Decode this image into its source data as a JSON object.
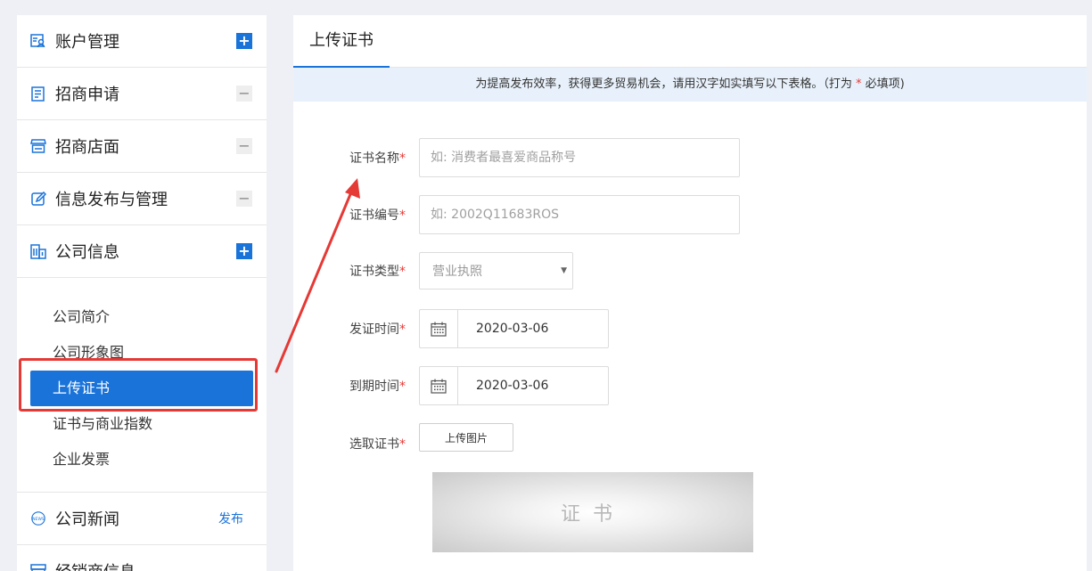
{
  "sidebar": {
    "items": [
      {
        "label": "账户管理",
        "icon": "account-icon",
        "toggle": "+"
      },
      {
        "label": "招商申请",
        "icon": "apply-icon",
        "toggle": "−"
      },
      {
        "label": "招商店面",
        "icon": "store-icon",
        "toggle": "−"
      },
      {
        "label": "信息发布与管理",
        "icon": "edit-icon",
        "toggle": "−"
      },
      {
        "label": "公司信息",
        "icon": "building-icon",
        "toggle": "+"
      }
    ],
    "company_sub": [
      "公司简介",
      "公司形象图",
      "上传证书",
      "证书与商业指数",
      "企业发票"
    ],
    "news": {
      "label": "公司新闻",
      "icon": "news-icon",
      "action": "发布"
    },
    "dealer": {
      "label": "经销商信息",
      "icon": "dealer-icon"
    }
  },
  "main": {
    "tab": "上传证书",
    "notice": {
      "before": "为提高发布效率，获得更多贸易机会，请用汉字如实填写以下表格。（打为",
      "star": "*",
      "after": "必填项)"
    },
    "form": {
      "cert_name": {
        "label": "证书名称",
        "placeholder": "如: 消费者最喜爱商品称号"
      },
      "cert_no": {
        "label": "证书编号",
        "placeholder": "如: 2002Q11683ROS"
      },
      "cert_type": {
        "label": "证书类型",
        "value": "营业执照"
      },
      "issue_date": {
        "label": "发证时间",
        "value": "2020-03-06"
      },
      "expire_date": {
        "label": "到期时间",
        "value": "2020-03-06"
      },
      "select_cert": {
        "label": "选取证书",
        "button": "上传图片"
      },
      "preview_text": "证书",
      "required_mark": "*"
    }
  },
  "colors": {
    "accent": "#1a73d9",
    "highlight": "#e53935",
    "notice_bg": "#e8f1fb"
  }
}
